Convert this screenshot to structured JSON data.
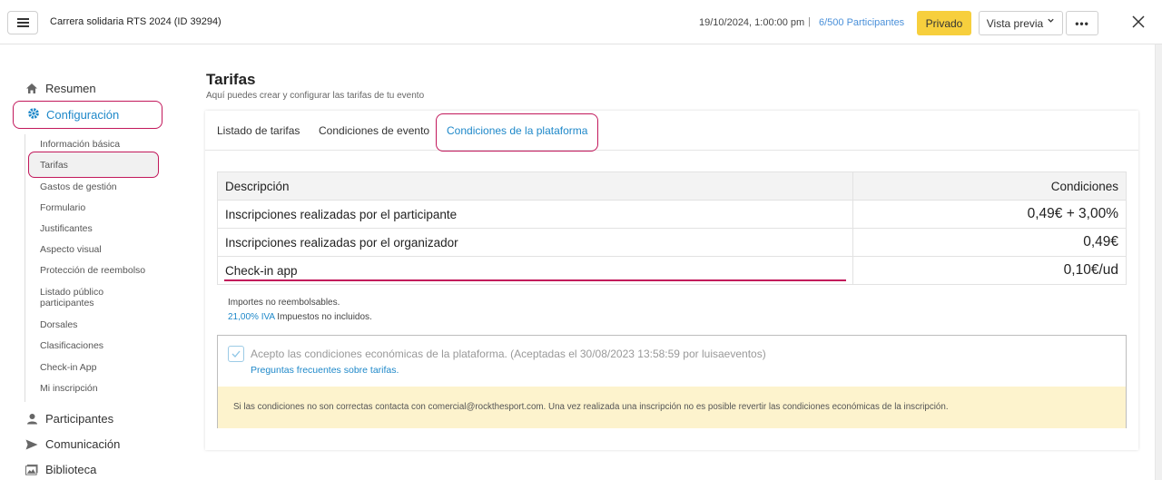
{
  "header": {
    "event_title": "Carrera solidaria RTS 2024 (ID 39294)",
    "date": "19/10/2024, 1:00:00 pm",
    "separator": "|",
    "participants_count": "6/500",
    "participants_label": "Participantes",
    "private_label": "Privado",
    "preview_label": "Vista previa",
    "preview_chevron": "⌄",
    "more_label": "•••",
    "close_label": "✕"
  },
  "sidebar": {
    "resumen": "Resumen",
    "configuracion": "Configuración",
    "sub_items": [
      "Información básica",
      "Tarifas",
      "Gastos de gestión",
      "Formulario",
      "Justificantes",
      "Aspecto visual",
      "Protección de reembolso",
      "Listado público",
      "participantes",
      "Dorsales",
      "Clasificaciones",
      "Check-in App",
      "Mi inscripción"
    ],
    "participantes": "Participantes",
    "comunicacion": "Comunicación",
    "biblioteca": "Biblioteca"
  },
  "main": {
    "title": "Tarifas",
    "subtitle": "Aquí puedes crear y configurar las tarifas de tu evento",
    "tabs": [
      "Listado de tarifas",
      "Condiciones de evento",
      "Condiciones de la plataforma"
    ],
    "table": {
      "headers": [
        "Descripción",
        "Condiciones"
      ],
      "rows": [
        [
          "Inscripciones realizadas por el participante",
          "0,49€ + 3,00%"
        ],
        [
          "Inscripciones realizadas por el organizador",
          "0,49€"
        ],
        [
          "Check-in app",
          "0,10€/ud"
        ]
      ]
    },
    "notes": {
      "non_refundable": "Importes no reembolsables.",
      "iva_link": "21,00% IVA",
      "iva_rest": " Impuestos no incluidos."
    },
    "accept": {
      "text": "Acepto las condiciones económicas de la plataforma. (Aceptadas el 30/08/2023 13:58:59 por luisaeventos)",
      "faq": "Preguntas frecuentes sobre tarifas.",
      "warning": "Si las condiciones no son correctas contacta con comercial@rockthesport.com. Una vez realizada una inscripción no es posible revertir las condiciones económicas de la inscripción."
    }
  },
  "colors": {
    "accent_blue": "#1e88c9",
    "highlight_pink": "#c2185b",
    "private_yellow": "#f7cf3d",
    "warning_bg": "#fdf3cd"
  }
}
